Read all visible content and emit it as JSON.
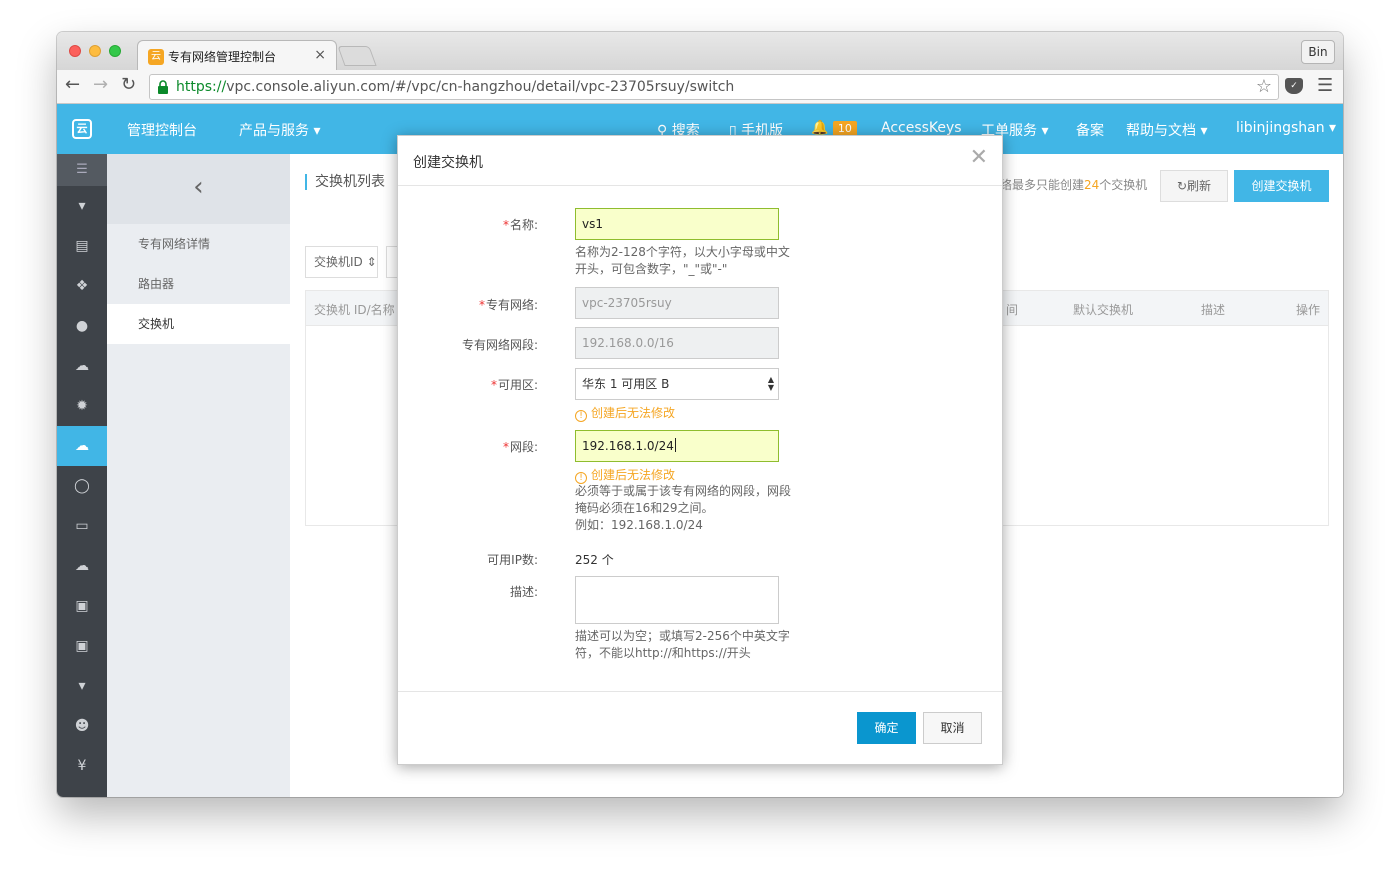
{
  "browser": {
    "tab_title": "专有网络管理控制台",
    "tab_close": "×",
    "profile": "Bin",
    "url_scheme": "https://",
    "url_rest": "vpc.console.aliyun.com/#/vpc/cn-hangzhou/detail/vpc-23705rsuy/switch"
  },
  "header": {
    "console": "管理控制台",
    "products": "产品与服务 ▾",
    "search": "搜索",
    "mobile": "手机版",
    "notifications": "10",
    "accesskeys": "AccessKeys",
    "tickets": "工单服务 ▾",
    "beian": "备案",
    "help": "帮助与文档 ▾",
    "user": "libinjingshan ▾"
  },
  "subnav": {
    "back": "‹",
    "items": [
      {
        "label": "专有网络详情"
      },
      {
        "label": "路由器"
      },
      {
        "label": "交换机"
      }
    ]
  },
  "main": {
    "title": "交换机列表",
    "hint_prefix": "络最多只能创建",
    "hint_count": "24",
    "hint_suffix": "个交换机",
    "refresh": "刷新",
    "create": "创建交换机",
    "filter_select": "交换机ID",
    "columns": [
      "交换机 ID/名称",
      "间",
      "默认交换机",
      "描述",
      "操作"
    ]
  },
  "dialog": {
    "title": "创建交换机",
    "name_label": "名称:",
    "name_value": "vs1",
    "name_help": "名称为2-128个字符，以大小字母或中文开头，可包含数字，\"_\"或\"-\"",
    "vpc_label": "专有网络:",
    "vpc_value": "vpc-23705rsuy",
    "cidr_label": "专有网络网段:",
    "cidr_value": "192.168.0.0/16",
    "zone_label": "可用区:",
    "zone_value": "华东 1 可用区 B",
    "zone_warn": "创建后无法修改",
    "subnet_label": "网段:",
    "subnet_value": "192.168.1.0/24",
    "subnet_warn": "创建后无法修改",
    "subnet_help": "必须等于或属于该专有网络的网段，网段掩码必须在16和29之间。",
    "subnet_example": "例如：192.168.1.0/24",
    "ip_label": "可用IP数:",
    "ip_value": "252 个",
    "desc_label": "描述:",
    "desc_help": "描述可以为空；或填写2-256个中英文字符，不能以http://和https://开头",
    "ok": "确定",
    "cancel": "取消",
    "required_mark": "*"
  },
  "colors": {
    "accent": "#41b6e6",
    "rail": "#3e4349",
    "warning": "#f5a623",
    "highlight_field": "#f9ffcb",
    "primary_button": "#0a96cf"
  }
}
